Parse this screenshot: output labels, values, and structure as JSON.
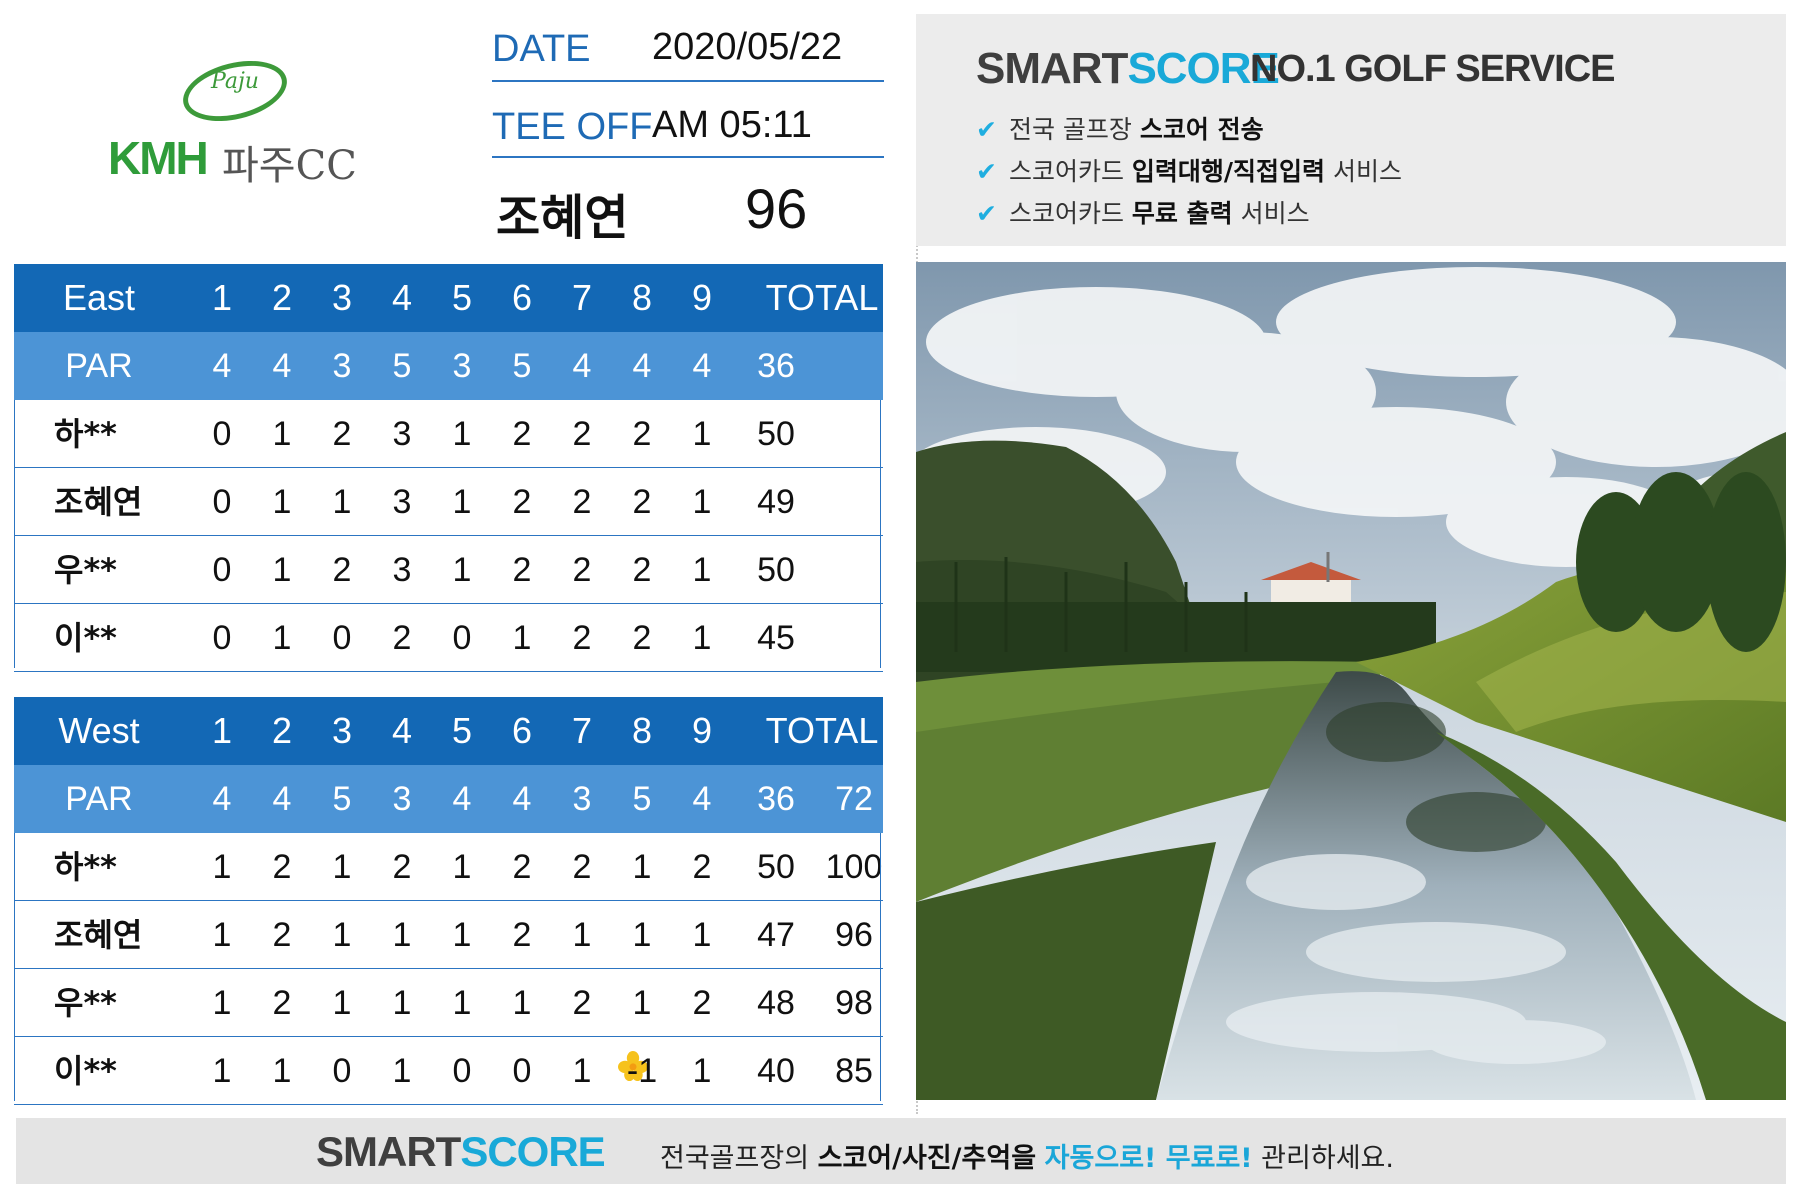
{
  "logo": {
    "script": "Paju",
    "brand": "KMH",
    "name": "파주CC"
  },
  "info": {
    "date_label": "DATE",
    "date_value": "2020/05/22",
    "tee_label": "TEE OFF",
    "tee_value": "AM 05:11",
    "player_name": "조혜연",
    "player_score": "96"
  },
  "east": {
    "title": "East",
    "holes": [
      "1",
      "2",
      "3",
      "4",
      "5",
      "6",
      "7",
      "8",
      "9"
    ],
    "total_label": "TOTAL",
    "par_label": "PAR",
    "par": [
      "4",
      "4",
      "3",
      "5",
      "3",
      "5",
      "4",
      "4",
      "4"
    ],
    "par_total": "36",
    "players": [
      {
        "name": "하**",
        "scores": [
          "0",
          "1",
          "2",
          "3",
          "1",
          "2",
          "2",
          "2",
          "1"
        ],
        "total": "50"
      },
      {
        "name": "조혜연",
        "scores": [
          "0",
          "1",
          "1",
          "3",
          "1",
          "2",
          "2",
          "2",
          "1"
        ],
        "total": "49"
      },
      {
        "name": "우**",
        "scores": [
          "0",
          "1",
          "2",
          "3",
          "1",
          "2",
          "2",
          "2",
          "1"
        ],
        "total": "50"
      },
      {
        "name": "이**",
        "scores": [
          "0",
          "1",
          "0",
          "2",
          "0",
          "1",
          "2",
          "2",
          "1"
        ],
        "total": "45"
      }
    ]
  },
  "west": {
    "title": "West",
    "holes": [
      "1",
      "2",
      "3",
      "4",
      "5",
      "6",
      "7",
      "8",
      "9"
    ],
    "total_label": "TOTAL",
    "par_label": "PAR",
    "par": [
      "4",
      "4",
      "5",
      "3",
      "4",
      "4",
      "3",
      "5",
      "4"
    ],
    "par_total": "36",
    "par_grand": "72",
    "players": [
      {
        "name": "하**",
        "scores": [
          "1",
          "2",
          "1",
          "2",
          "1",
          "2",
          "2",
          "1",
          "2"
        ],
        "total": "50",
        "grand": "100"
      },
      {
        "name": "조혜연",
        "scores": [
          "1",
          "2",
          "1",
          "1",
          "1",
          "2",
          "1",
          "1",
          "1"
        ],
        "total": "47",
        "grand": "96"
      },
      {
        "name": "우**",
        "scores": [
          "1",
          "2",
          "1",
          "1",
          "1",
          "1",
          "2",
          "1",
          "2"
        ],
        "total": "48",
        "grand": "98"
      },
      {
        "name": "이**",
        "scores": [
          "1",
          "1",
          "0",
          "1",
          "0",
          "0",
          "1",
          "-1",
          "1"
        ],
        "total": "40",
        "grand": "85"
      }
    ]
  },
  "promo": {
    "brand_smart": "SMART",
    "brand_score": "SCORE",
    "tagline": "NO.1 GOLF SERVICE",
    "bullets": [
      {
        "pre": "전국 골프장 ",
        "bold": "스코어 전송",
        "post": ""
      },
      {
        "pre": "스코어카드 ",
        "bold": "입력대행/직접입력",
        "post": " 서비스"
      },
      {
        "pre": "스코어카드 ",
        "bold": "무료 출력",
        "post": " 서비스"
      }
    ]
  },
  "footer": {
    "brand_smart": "SMART",
    "brand_score": "SCORE",
    "text_pre": "전국골프장의 ",
    "text_bold": "스코어/사진/추억을",
    "text_mid": " ",
    "text_hl1": "자동으로!",
    "text_hl2": " 무료로!",
    "text_post": " 관리하세요."
  },
  "colors": {
    "header_blue": "#1368b5",
    "par_blue": "#4c94d6",
    "accent_cyan": "#19a9d8"
  }
}
